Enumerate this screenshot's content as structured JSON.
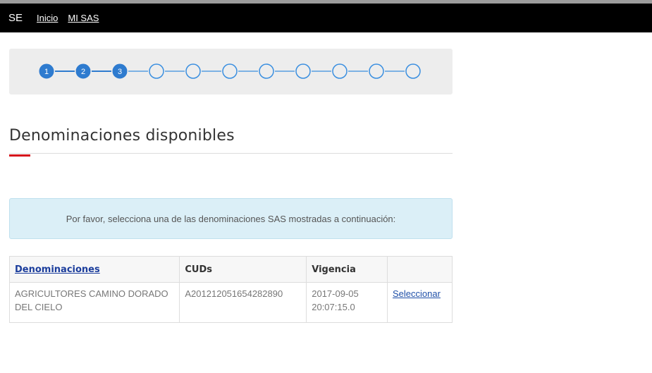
{
  "header": {
    "brand": "SE",
    "nav": [
      "Inicio",
      "MI SAS"
    ]
  },
  "stepper": {
    "total_steps": 11,
    "completed_steps": 3,
    "labels": [
      "1",
      "2",
      "3"
    ],
    "active_color": "#2e7bcf",
    "inactive_color": "#3a8fe0"
  },
  "page": {
    "title": "Denominaciones disponibles",
    "accent_color": "#d6101b"
  },
  "alert": {
    "text": "Por favor, selecciona una de las denominaciones SAS mostradas a continuación:"
  },
  "table": {
    "headers": [
      "Denominaciones",
      "CUDs",
      "Vigencia",
      ""
    ],
    "rows": [
      {
        "denominacion": "AGRICULTORES CAMINO DORADO DEL CIELO",
        "cud": "A201212051654282890",
        "vigencia": "2017-09-05 20:07:15.0",
        "action": "Seleccionar"
      }
    ]
  }
}
